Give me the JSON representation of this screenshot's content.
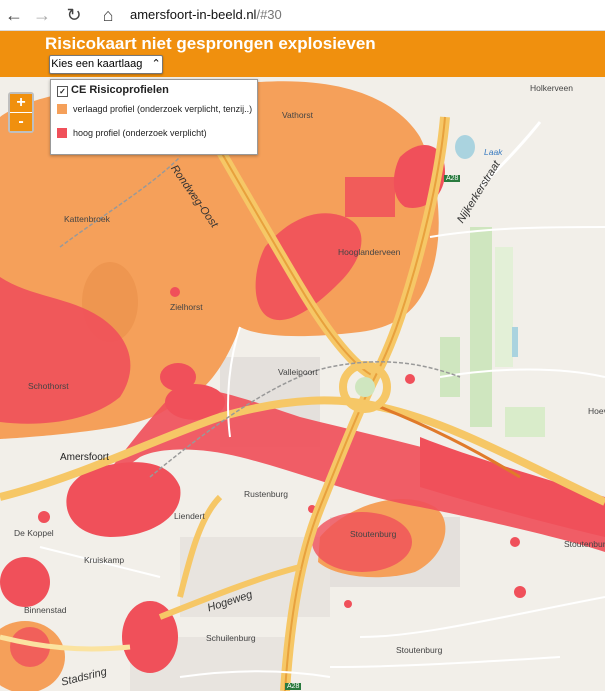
{
  "browser": {
    "back_icon": "←",
    "forward_icon": "→",
    "reload_icon": "↻",
    "home_icon": "⌂",
    "url_host": "amersfoort-in-beeld.nl",
    "url_path": "/#30"
  },
  "header": {
    "title": "Risicokaart niet gesprongen explosieven",
    "layer_button": "Kies een kaartlaag",
    "layer_button_icon": "⌃"
  },
  "zoom": {
    "in": "+",
    "out": "-"
  },
  "legend": {
    "title": "CE Risicoprofielen",
    "check": "✓",
    "items": [
      {
        "label": "verlaagd profiel (onderzoek verplicht, tenzij..)",
        "color": "#f5a05a"
      },
      {
        "label": "hoog profiel (onderzoek verplicht)",
        "color": "#f0505a"
      }
    ]
  },
  "map_labels": {
    "vathorst": "Vathorst",
    "kattenbroek": "Kattenbroek",
    "zielhorst": "Zielhorst",
    "schothorst": "Schothorst",
    "amersfoort": "Amersfoort",
    "de_koppel": "De Koppel",
    "kruiskamp": "Kruiskamp",
    "liendert": "Liendert",
    "rustenburg": "Rustenburg",
    "vallelpoort": "Valleipoort",
    "hooglanderveen": "Hooglanderveen",
    "holkerveen": "Holkerveen",
    "nijkerkerstraat": "Nijkerkerstraat",
    "stoutenburg": "Stoutenburg",
    "stoutenburg2": "Stoutenburg",
    "stoutenburg3": "Stoutenburg",
    "binnenstad": "Binnenstad",
    "schuilenburg": "Schuilenburg",
    "hogeweg": "Hogeweg",
    "stadsring": "Stadsring",
    "hoev": "Hoev",
    "laak": "Laak",
    "rondweg_oost": "Rondweg-Oost",
    "a28_1": "A28",
    "a28_2": "A28"
  }
}
